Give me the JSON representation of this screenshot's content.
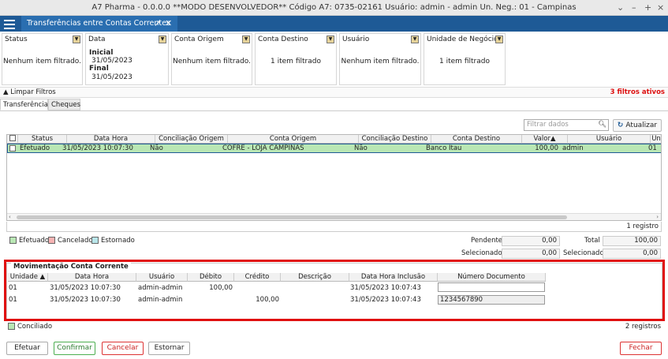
{
  "window": {
    "title": "A7 Pharma - 0.0.0.0   **MODO DESENVOLVEDOR**   Código A7: 0735-02161   Usuário: admin - admin   Un. Neg.: 01 - Campinas",
    "controls": [
      "⌄",
      "–",
      "+",
      "×"
    ]
  },
  "tab": {
    "label": "Transferências entre Contas Correntes",
    "pin": "↗",
    "close": "✕"
  },
  "filters": [
    {
      "title": "Status",
      "content": "Nenhum item filtrado."
    },
    {
      "title": "Data",
      "inicial_label": "Inicial",
      "inicial": "31/05/2023",
      "final_label": "Final",
      "final": "31/05/2023"
    },
    {
      "title": "Conta Origem",
      "content": "Nenhum item filtrado."
    },
    {
      "title": "Conta Destino",
      "content": "1 item filtrado"
    },
    {
      "title": "Usuário",
      "content": "Nenhum item filtrado."
    },
    {
      "title": "Unidade de Negócio",
      "content": "1 item filtrado"
    }
  ],
  "limpar": {
    "label": "Limpar Filtros",
    "count": "3 filtros ativos"
  },
  "subtabs": [
    "Transferências",
    "Cheques"
  ],
  "search": {
    "placeholder": "Filtrar dados"
  },
  "atualizar": "Atualizar",
  "grid": {
    "headers": [
      "Status",
      "Data Hora",
      "Conciliação Origem",
      "Conta Origem",
      "Conciliação Destino",
      "Conta Destino",
      "Valor",
      "Usuário",
      "Un"
    ],
    "rows": [
      {
        "status": "Efetuado",
        "data_hora": "31/05/2023 10:07:30",
        "conc_origem": "Não",
        "conta_origem": "COFRE - LOJA CAMPINAS",
        "conc_destino": "Não",
        "conta_destino": "Banco Itau",
        "valor": "100,00",
        "usuario": "admin",
        "un": "01"
      }
    ],
    "count": "1 registro"
  },
  "legend": [
    "Efetuado",
    "Cancelado",
    "Estornado"
  ],
  "legend_colors": [
    "#b9e7b4",
    "#f7b3b3",
    "#b9e6ea"
  ],
  "totals": {
    "pendente_label": "Pendente",
    "pendente": "0,00",
    "total_label": "Total",
    "total": "100,00",
    "sel_label": "Selecionado",
    "sel": "0,00",
    "sel2_label": "Selecionado",
    "sel2": "0,00"
  },
  "mov": {
    "title": "Movimentação Conta Corrente",
    "headers": [
      "Unidade",
      "Data Hora",
      "Usuário",
      "Débito",
      "Crédito",
      "Descrição",
      "Data Hora Inclusão",
      "Número Documento"
    ],
    "rows": [
      {
        "unidade": "01",
        "data_hora": "31/05/2023 10:07:30",
        "usuario": "admin-admin",
        "debito": "100,00",
        "credito": "",
        "descricao": "",
        "inclusao": "31/05/2023 10:07:43",
        "documento": ""
      },
      {
        "unidade": "01",
        "data_hora": "31/05/2023 10:07:30",
        "usuario": "admin-admin",
        "debito": "",
        "credito": "100,00",
        "descricao": "",
        "inclusao": "31/05/2023 10:07:43",
        "documento": "1234567890"
      }
    ]
  },
  "conciliado": "Conciliado",
  "mov_count": "2 registros",
  "buttons": {
    "efetuar": "Efetuar",
    "confirmar": "Confirmar",
    "cancelar": "Cancelar",
    "estornar": "Estornar",
    "fechar": "Fechar"
  }
}
